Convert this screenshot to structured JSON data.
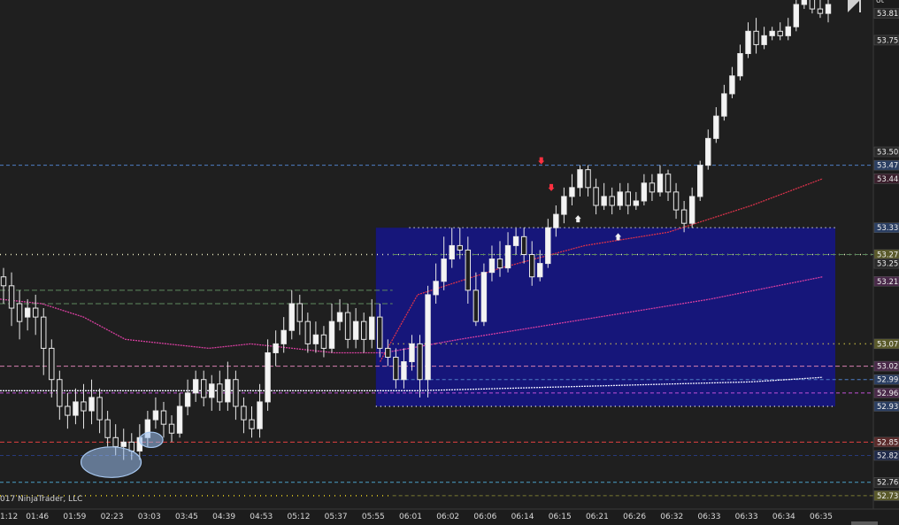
{
  "copyright": "017 NinjaTrader, LLC",
  "top_right_label": "ot",
  "chart_data": {
    "type": "candlestick",
    "title": "",
    "ylim": [
      52.7,
      53.84
    ],
    "grid": false,
    "x_ticks": [
      "1:12",
      "01:46",
      "01:59",
      "02:23",
      "03:03",
      "03:45",
      "04:39",
      "04:53",
      "05:12",
      "05:37",
      "05:55",
      "06:01",
      "06:02",
      "06:06",
      "06:14",
      "06:15",
      "06:21",
      "06:26",
      "06:32",
      "06:33",
      "06:33",
      "06:34",
      "06:35"
    ],
    "price_labels": [
      {
        "text": "53.81",
        "value": 53.81,
        "color": "#2a2a2a"
      },
      {
        "text": "53.75",
        "value": 53.75,
        "color": "#2a2a2a"
      },
      {
        "text": "53.50",
        "value": 53.5,
        "color": "#2a2a2a"
      },
      {
        "text": "53.47",
        "value": 53.47,
        "color": "#2b3f63"
      },
      {
        "text": "53.44",
        "value": 53.44,
        "color": "#3a1f2c"
      },
      {
        "text": "53.33",
        "value": 53.33,
        "color": "#2b3f63"
      },
      {
        "text": "53.27",
        "value": 53.27,
        "color": "#5a5a2a"
      },
      {
        "text": "53.25",
        "value": 53.25,
        "color": "#2a2a2a"
      },
      {
        "text": "53.21",
        "value": 53.21,
        "color": "#4a2a4a"
      },
      {
        "text": "53.07",
        "value": 53.07,
        "color": "#5a5a2a"
      },
      {
        "text": "53.02",
        "value": 53.02,
        "color": "#4a2a4a"
      },
      {
        "text": "52.99",
        "value": 52.99,
        "color": "#2b3f63"
      },
      {
        "text": "52.96",
        "value": 52.96,
        "color": "#4a2a4a"
      },
      {
        "text": "52.93",
        "value": 52.93,
        "color": "#2b3f63"
      },
      {
        "text": "52.85",
        "value": 52.85,
        "color": "#5a2a2a"
      },
      {
        "text": "52.82",
        "value": 52.82,
        "color": "#1f2a4a"
      },
      {
        "text": "52.76",
        "value": 52.76,
        "color": "#2a2a2a"
      },
      {
        "text": "52.73",
        "value": 52.73,
        "color": "#5a5a2a"
      }
    ],
    "levels": [
      {
        "name": "level-blue-53.47",
        "value": 53.47,
        "x_start": 0,
        "x_end": 1,
        "color": "#4f7fc6",
        "dash": "4,3"
      },
      {
        "name": "level-yellow-53.27",
        "value": 53.27,
        "x_start": 0,
        "x_end": 1,
        "color": "#e8e8c0",
        "dash": "1,5"
      },
      {
        "name": "level-green-53.27",
        "value": 53.27,
        "x_start": 0.47,
        "x_end": 1,
        "color": "#5f8a5f",
        "dash": "6,3"
      },
      {
        "name": "level-green-53.19",
        "value": 53.19,
        "x_start": 0,
        "x_end": 0.47,
        "color": "#5f8a5f",
        "dash": "6,3"
      },
      {
        "name": "level-green-53.16",
        "value": 53.16,
        "x_start": 0,
        "x_end": 0.47,
        "color": "#5f8a5f",
        "dash": "6,3"
      },
      {
        "name": "level-yellow-53.07",
        "value": 53.07,
        "x_start": 0.47,
        "x_end": 1,
        "color": "#e6d84a",
        "dash": "1,5"
      },
      {
        "name": "level-pink-53.02",
        "value": 53.02,
        "x_start": 0,
        "x_end": 1,
        "color": "#d87fb0",
        "dash": "5,3"
      },
      {
        "name": "level-blue-52.99",
        "value": 52.99,
        "x_start": 0.47,
        "x_end": 1,
        "color": "#4f7fc6",
        "dash": "4,3"
      },
      {
        "name": "level-violet-52.96",
        "value": 52.96,
        "x_start": 0,
        "x_end": 1,
        "color": "#c050d8",
        "dash": "4,3"
      },
      {
        "name": "level-red-52.85",
        "value": 52.85,
        "x_start": 0,
        "x_end": 1,
        "color": "#e04040",
        "dash": "5,3"
      },
      {
        "name": "level-navy-52.82",
        "value": 52.82,
        "x_start": 0,
        "x_end": 1,
        "color": "#283a7a",
        "dash": "4,3"
      },
      {
        "name": "level-cyan-52.76",
        "value": 52.76,
        "x_start": 0,
        "x_end": 1,
        "color": "#4aa0c8",
        "dash": "4,3"
      },
      {
        "name": "level-yellow-52.73",
        "value": 52.73,
        "x_start": 0,
        "x_end": 0.47,
        "color": "#e6d020",
        "dash": "1,5"
      },
      {
        "name": "level-olive-52.73",
        "value": 52.73,
        "x_start": 0.47,
        "x_end": 1,
        "color": "#7a7a30",
        "dash": "4,3"
      }
    ],
    "value_area": {
      "top": 53.33,
      "bottom": 52.93,
      "color": "#16167a",
      "border": "#e8e8e8"
    },
    "moving_averages": [
      {
        "name": "ma-red",
        "color": "#d8324a",
        "points": [
          [
            0.455,
            53.03
          ],
          [
            0.5,
            53.18
          ],
          [
            0.6,
            53.24
          ],
          [
            0.7,
            53.29
          ],
          [
            0.8,
            53.32
          ],
          [
            0.9,
            53.38
          ],
          [
            0.985,
            53.44
          ]
        ]
      },
      {
        "name": "ma-magenta",
        "color": "#d83fa0",
        "points": [
          [
            0,
            53.17
          ],
          [
            0.05,
            53.16
          ],
          [
            0.1,
            53.13
          ],
          [
            0.15,
            53.08
          ],
          [
            0.2,
            53.07
          ],
          [
            0.25,
            53.06
          ],
          [
            0.3,
            53.07
          ],
          [
            0.35,
            53.06
          ],
          [
            0.4,
            53.05
          ],
          [
            0.46,
            53.05
          ],
          [
            0.55,
            53.08
          ],
          [
            0.65,
            53.11
          ],
          [
            0.75,
            53.14
          ],
          [
            0.85,
            53.17
          ],
          [
            0.985,
            53.22
          ]
        ]
      },
      {
        "name": "ma-white",
        "color": "#f0f0ff",
        "points": [
          [
            0,
            52.965
          ],
          [
            0.2,
            52.965
          ],
          [
            0.4,
            52.965
          ],
          [
            0.5,
            52.965
          ],
          [
            0.6,
            52.97
          ],
          [
            0.7,
            52.975
          ],
          [
            0.8,
            52.98
          ],
          [
            0.9,
            52.985
          ],
          [
            0.985,
            52.995
          ]
        ]
      }
    ],
    "candles": [
      [
        53.22,
        53.2,
        53.24,
        53.16
      ],
      [
        53.2,
        53.15,
        53.23,
        53.11
      ],
      [
        53.16,
        53.12,
        53.19,
        53.08
      ],
      [
        53.13,
        53.15,
        53.17,
        53.1
      ],
      [
        53.15,
        53.13,
        53.18,
        53.09
      ],
      [
        53.13,
        53.06,
        53.15,
        53.0
      ],
      [
        53.06,
        52.99,
        53.08,
        52.95
      ],
      [
        52.99,
        52.93,
        53.01,
        52.9
      ],
      [
        52.93,
        52.91,
        52.96,
        52.88
      ],
      [
        52.91,
        52.94,
        52.97,
        52.89
      ],
      [
        52.94,
        52.92,
        52.98,
        52.88
      ],
      [
        52.92,
        52.95,
        52.99,
        52.89
      ],
      [
        52.95,
        52.9,
        52.97,
        52.87
      ],
      [
        52.9,
        52.86,
        52.92,
        52.84
      ],
      [
        52.86,
        52.84,
        52.89,
        52.82
      ],
      [
        52.84,
        52.85,
        52.88,
        52.81
      ],
      [
        52.85,
        52.83,
        52.87,
        52.81
      ],
      [
        52.83,
        52.86,
        52.89,
        52.81
      ],
      [
        52.86,
        52.9,
        52.92,
        52.84
      ],
      [
        52.9,
        52.92,
        52.95,
        52.88
      ],
      [
        52.92,
        52.89,
        52.94,
        52.86
      ],
      [
        52.89,
        52.87,
        52.91,
        52.85
      ],
      [
        52.87,
        52.93,
        52.96,
        52.86
      ],
      [
        52.93,
        52.96,
        52.99,
        52.91
      ],
      [
        52.96,
        52.99,
        53.01,
        52.94
      ],
      [
        52.99,
        52.95,
        53.01,
        52.93
      ],
      [
        52.95,
        52.98,
        53.0,
        52.92
      ],
      [
        52.98,
        52.94,
        53.01,
        52.92
      ],
      [
        52.94,
        52.99,
        53.03,
        52.92
      ],
      [
        52.99,
        52.93,
        53.01,
        52.9
      ],
      [
        52.93,
        52.9,
        52.95,
        52.87
      ],
      [
        52.9,
        52.88,
        52.93,
        52.86
      ],
      [
        52.88,
        52.94,
        52.98,
        52.86
      ],
      [
        52.94,
        53.05,
        53.08,
        52.92
      ],
      [
        53.05,
        53.07,
        53.1,
        53.02
      ],
      [
        53.07,
        53.1,
        53.13,
        53.05
      ],
      [
        53.1,
        53.16,
        53.19,
        53.08
      ],
      [
        53.16,
        53.12,
        53.18,
        53.09
      ],
      [
        53.12,
        53.07,
        53.14,
        53.05
      ],
      [
        53.07,
        53.09,
        53.12,
        53.05
      ],
      [
        53.09,
        53.06,
        53.11,
        53.04
      ],
      [
        53.06,
        53.12,
        53.16,
        53.05
      ],
      [
        53.12,
        53.14,
        53.17,
        53.1
      ],
      [
        53.14,
        53.08,
        53.16,
        53.06
      ],
      [
        53.08,
        53.12,
        53.15,
        53.06
      ],
      [
        53.12,
        53.08,
        53.14,
        53.05
      ],
      [
        53.08,
        53.13,
        53.17,
        53.06
      ],
      [
        53.13,
        53.06,
        53.16,
        53.04
      ],
      [
        53.06,
        53.04,
        53.08,
        53.02
      ],
      [
        53.04,
        52.99,
        53.06,
        52.97
      ],
      [
        52.99,
        53.03,
        53.06,
        52.97
      ],
      [
        53.03,
        53.07,
        53.09,
        53.01
      ],
      [
        53.07,
        52.99,
        53.09,
        52.95
      ],
      [
        52.99,
        53.18,
        53.2,
        52.95
      ],
      [
        53.18,
        53.21,
        53.25,
        53.16
      ],
      [
        53.21,
        53.26,
        53.31,
        53.19
      ],
      [
        53.26,
        53.29,
        53.33,
        53.24
      ],
      [
        53.29,
        53.28,
        53.33,
        53.26
      ],
      [
        53.28,
        53.19,
        53.31,
        53.16
      ],
      [
        53.19,
        53.12,
        53.23,
        53.11
      ],
      [
        53.12,
        53.23,
        53.25,
        53.11
      ],
      [
        53.23,
        53.26,
        53.29,
        53.21
      ],
      [
        53.26,
        53.24,
        53.3,
        53.22
      ],
      [
        53.24,
        53.29,
        53.32,
        53.23
      ],
      [
        53.29,
        53.31,
        53.33,
        53.27
      ],
      [
        53.31,
        53.27,
        53.33,
        53.25
      ],
      [
        53.27,
        53.22,
        53.3,
        53.2
      ],
      [
        53.22,
        53.25,
        53.28,
        53.21
      ],
      [
        53.25,
        53.33,
        53.35,
        53.24
      ],
      [
        53.33,
        53.36,
        53.38,
        53.31
      ],
      [
        53.36,
        53.4,
        53.42,
        53.34
      ],
      [
        53.4,
        53.42,
        53.45,
        53.38
      ],
      [
        53.42,
        53.46,
        53.47,
        53.4
      ],
      [
        53.46,
        53.42,
        53.47,
        53.4
      ],
      [
        53.42,
        53.38,
        53.44,
        53.36
      ],
      [
        53.38,
        53.4,
        53.43,
        53.37
      ],
      [
        53.4,
        53.38,
        53.42,
        53.36
      ],
      [
        53.38,
        53.41,
        53.43,
        53.37
      ],
      [
        53.41,
        53.38,
        53.43,
        53.36
      ],
      [
        53.38,
        53.39,
        53.41,
        53.37
      ],
      [
        53.39,
        53.43,
        53.45,
        53.38
      ],
      [
        53.43,
        53.41,
        53.45,
        53.39
      ],
      [
        53.41,
        53.45,
        53.47,
        53.4
      ],
      [
        53.45,
        53.41,
        53.46,
        53.39
      ],
      [
        53.41,
        53.37,
        53.43,
        53.35
      ],
      [
        53.37,
        53.34,
        53.39,
        53.32
      ],
      [
        53.34,
        53.4,
        53.42,
        53.33
      ],
      [
        53.4,
        53.47,
        53.48,
        53.39
      ],
      [
        53.47,
        53.53,
        53.55,
        53.46
      ],
      [
        53.53,
        53.58,
        53.6,
        53.52
      ],
      [
        53.58,
        53.63,
        53.65,
        53.57
      ],
      [
        53.63,
        53.67,
        53.69,
        53.62
      ],
      [
        53.67,
        53.72,
        53.74,
        53.66
      ],
      [
        53.72,
        53.77,
        53.79,
        53.71
      ],
      [
        53.77,
        53.74,
        53.8,
        53.72
      ],
      [
        53.74,
        53.76,
        53.78,
        53.73
      ],
      [
        53.76,
        53.77,
        53.78,
        53.75
      ],
      [
        53.77,
        53.76,
        53.79,
        53.75
      ],
      [
        53.76,
        53.78,
        53.8,
        53.75
      ],
      [
        53.78,
        53.83,
        53.85,
        53.77
      ],
      [
        53.83,
        53.86,
        53.88,
        53.82
      ],
      [
        53.86,
        53.82,
        53.88,
        53.81
      ],
      [
        53.82,
        53.81,
        53.84,
        53.8
      ],
      [
        53.81,
        53.83,
        53.84,
        53.79
      ]
    ],
    "annotations": [
      {
        "name": "dip-ellipse-large",
        "x": 0.133,
        "y": 52.805,
        "rx": 0.036,
        "ry": 0.03,
        "color": "#a8c8f0"
      },
      {
        "name": "dip-ellipse-small",
        "x": 0.181,
        "y": 52.855,
        "rx": 0.014,
        "ry": 0.015,
        "color": "#a8c8f0"
      }
    ],
    "signal_markers": [
      {
        "name": "sell-marker",
        "x": 0.648,
        "y": 53.48,
        "color": "#ff3040",
        "shape": "down"
      },
      {
        "name": "sell-marker",
        "x": 0.66,
        "y": 53.42,
        "color": "#ff3040",
        "shape": "down"
      },
      {
        "name": "buy-marker",
        "x": 0.692,
        "y": 53.35,
        "color": "#f0f0f0",
        "shape": "up"
      },
      {
        "name": "buy-marker",
        "x": 0.74,
        "y": 53.31,
        "color": "#f0f0f0",
        "shape": "up"
      }
    ]
  }
}
